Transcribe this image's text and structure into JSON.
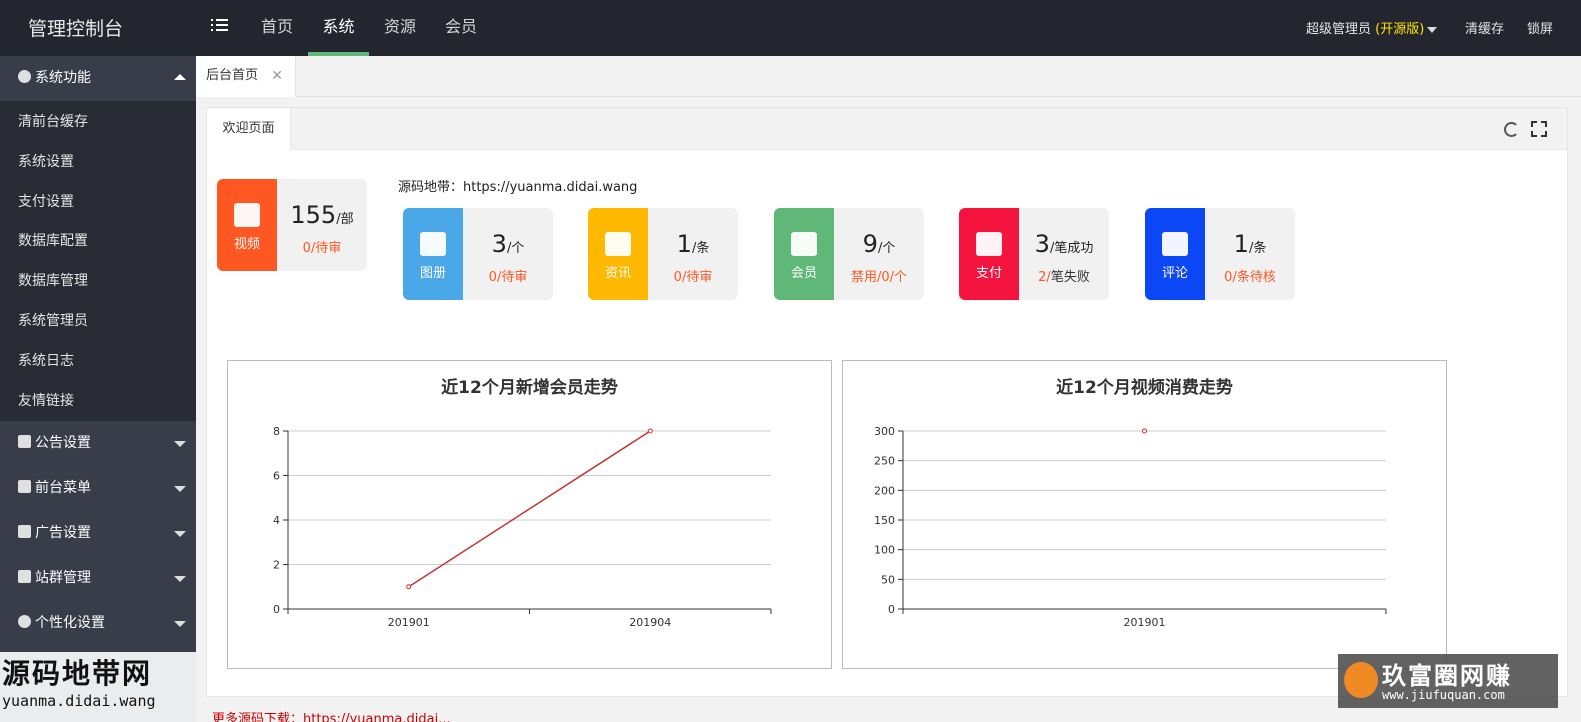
{
  "header": {
    "logo": "管理控制台",
    "nav": [
      {
        "label": "首页",
        "active": false
      },
      {
        "label": "系统",
        "active": true
      },
      {
        "label": "资源",
        "active": false
      },
      {
        "label": "会员",
        "active": false
      }
    ],
    "user": "超级管理员",
    "edition": "(开源版)",
    "clear_cache": "清缓存",
    "lock": "锁屏"
  },
  "sidebar": {
    "groups": [
      {
        "label": "系统功能",
        "icon": "gear-icon",
        "open": true
      },
      {
        "label": "公告设置",
        "icon": "book-icon",
        "open": false
      },
      {
        "label": "前台菜单",
        "icon": "list-icon",
        "open": false
      },
      {
        "label": "广告设置",
        "icon": "image-icon",
        "open": false
      },
      {
        "label": "站群管理",
        "icon": "sitemap-icon",
        "open": false
      },
      {
        "label": "个性化设置",
        "icon": "dashboard-icon",
        "open": false
      }
    ],
    "items": [
      "清前台缓存",
      "系统设置",
      "支付设置",
      "数据库配置",
      "数据库管理",
      "系统管理员",
      "系统日志",
      "友情链接"
    ]
  },
  "tabs": {
    "main_tab": "后台首页",
    "close": "✕",
    "panel_tab": "欢迎页面"
  },
  "source": "源码地带：https://yuanma.didai.wang",
  "cards": [
    {
      "label": "视频",
      "icon": "film-icon",
      "color": "#ff5722",
      "num": "155",
      "unit": "/部",
      "sub": "0/待审",
      "sub_dark": ""
    },
    {
      "label": "图册",
      "icon": "picture-icon",
      "color": "#4aa8e8",
      "num": "3",
      "unit": "/个",
      "sub": "0/待审",
      "sub_dark": ""
    },
    {
      "label": "资讯",
      "icon": "document-icon",
      "color": "#ffb800",
      "num": "1",
      "unit": "/条",
      "sub": "0/待审",
      "sub_dark": ""
    },
    {
      "label": "会员",
      "icon": "users-icon",
      "color": "#5fb878",
      "num": "9",
      "unit": "/个",
      "sub": "禁用/0/个",
      "sub_dark": ""
    },
    {
      "label": "支付",
      "icon": "user-icon",
      "color": "#f5143d",
      "num": "3",
      "unit": "/笔成功",
      "sub": "2/",
      "sub_dark": "笔失败"
    },
    {
      "label": "评论",
      "icon": "user-icon",
      "color": "#0c47f5",
      "num": "1",
      "unit": "/条",
      "sub": "0/条待核",
      "sub_dark": ""
    }
  ],
  "chart_data": [
    {
      "type": "line",
      "title": "近12个月新增会员走势",
      "x": [
        "201901",
        "201904"
      ],
      "values": [
        1,
        8
      ],
      "ylim": [
        0,
        8
      ],
      "yticks": [
        0,
        2,
        4,
        6,
        8
      ],
      "line_color": "#c23531",
      "grid": true
    },
    {
      "type": "line",
      "title": "近12个月视频消费走势",
      "x": [
        "201901"
      ],
      "values": [
        300
      ],
      "ylim": [
        0,
        300
      ],
      "yticks": [
        0,
        50,
        100,
        150,
        200,
        250,
        300
      ],
      "line_color": "#c23531",
      "grid": true
    }
  ],
  "footer": {
    "text": "更多源码下载：https://yuanma.didai..."
  },
  "watermarks": {
    "left_big": "源码地带网",
    "left_small": "yuanma.didai.wang",
    "right_big": "玖富圈网赚",
    "right_small": "www.jiufuquan.com"
  }
}
